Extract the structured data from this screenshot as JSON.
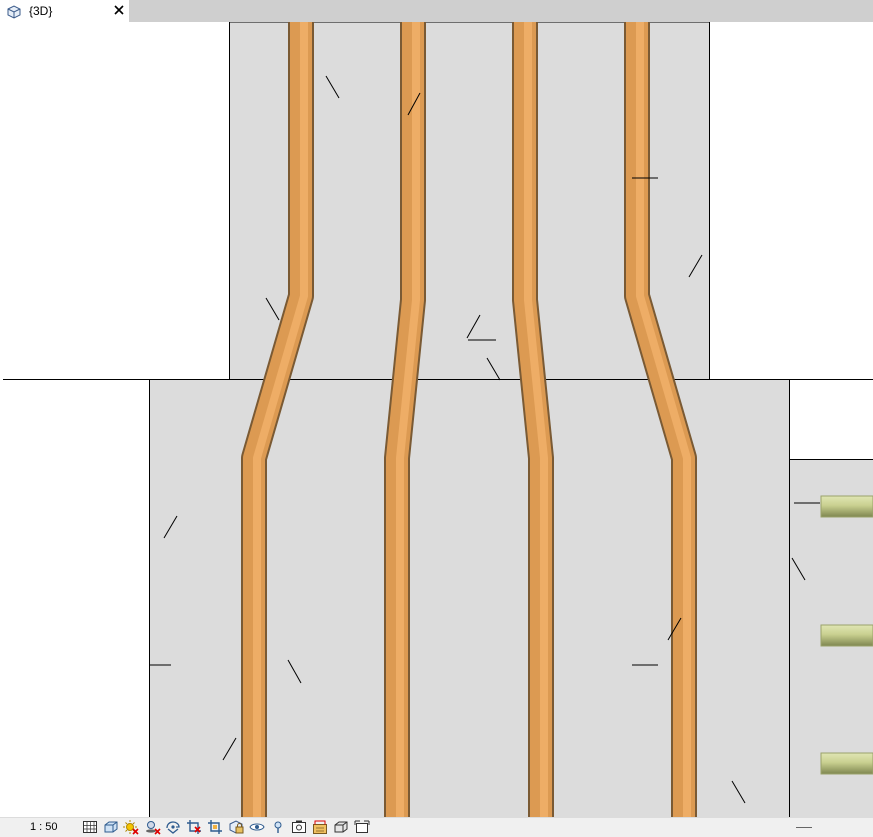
{
  "tab": {
    "title": "{3D}",
    "icon": "3d-view-icon",
    "close_icon": "close-icon"
  },
  "colors": {
    "pipe_light": "#efb068",
    "pipe_mid": "#d9954e",
    "pipe_dark": "#7a5a34",
    "green_light": "#d4dca0",
    "green_dark": "#7e8650",
    "wall": "#dcdcdc",
    "background": "#ffffff",
    "tabbar": "#cfcfcf"
  },
  "status": {
    "scale": "1 : 50",
    "tools": [
      "detail-level-icon",
      "visual-style-icon",
      "sun-path-icon",
      "shadows-off-icon",
      "rendering-icon",
      "crop-view-icon",
      "hide-crop-icon",
      "lock-3d-view-icon",
      "temporary-hide-icon",
      "reveal-hidden-icon",
      "analytical-model-icon",
      "highlight-displacement-icon",
      "reveal-constraints-icon",
      "worksharing-display-icon"
    ]
  }
}
